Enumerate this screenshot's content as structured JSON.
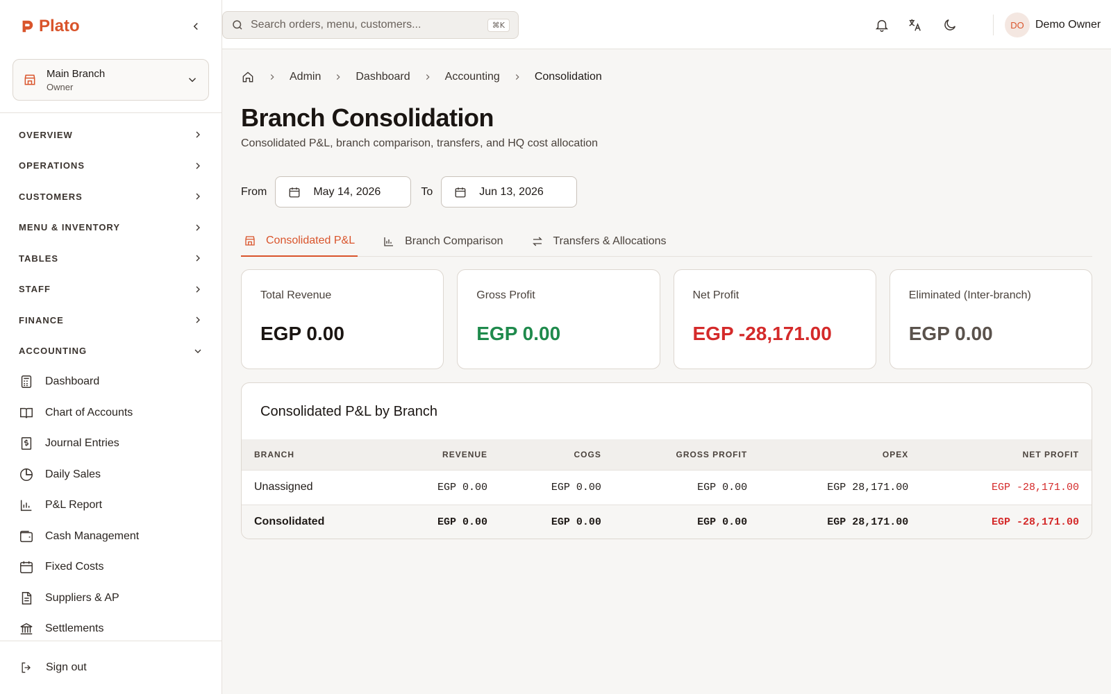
{
  "app": {
    "name": "Plato"
  },
  "branch": {
    "name": "Main Branch",
    "role": "Owner"
  },
  "nav": {
    "sections": [
      "OVERVIEW",
      "OPERATIONS",
      "CUSTOMERS",
      "MENU & INVENTORY",
      "TABLES",
      "STAFF",
      "FINANCE",
      "ACCOUNTING"
    ],
    "accounting_items": [
      "Dashboard",
      "Chart of Accounts",
      "Journal Entries",
      "Daily Sales",
      "P&L Report",
      "Cash Management",
      "Fixed Costs",
      "Suppliers & AP",
      "Settlements"
    ],
    "signout": "Sign out"
  },
  "search": {
    "placeholder": "Search orders, menu, customers...",
    "shortcut": "⌘K"
  },
  "user": {
    "initials": "DO",
    "name": "Demo Owner"
  },
  "breadcrumb": [
    "Admin",
    "Dashboard",
    "Accounting",
    "Consolidation"
  ],
  "page": {
    "title": "Branch Consolidation",
    "subtitle": "Consolidated P&L, branch comparison, transfers, and HQ cost allocation"
  },
  "dates": {
    "from_label": "From",
    "from": "May 14, 2026",
    "to_label": "To",
    "to": "Jun 13, 2026"
  },
  "tabs": [
    "Consolidated P&L",
    "Branch Comparison",
    "Transfers & Allocations"
  ],
  "cards": [
    {
      "label": "Total Revenue",
      "value": "EGP 0.00",
      "color": "#1a1512"
    },
    {
      "label": "Gross Profit",
      "value": "EGP 0.00",
      "color": "#1f8a4c"
    },
    {
      "label": "Net Profit",
      "value": "EGP -28,171.00",
      "color": "#d42a2a"
    },
    {
      "label": "Eliminated (Inter-branch)",
      "value": "EGP 0.00",
      "color": "#5a524c"
    }
  ],
  "table": {
    "title": "Consolidated P&L by Branch",
    "headers": [
      "BRANCH",
      "REVENUE",
      "COGS",
      "GROSS PROFIT",
      "OPEX",
      "NET PROFIT"
    ],
    "rows": [
      [
        "Unassigned",
        "EGP 0.00",
        "EGP 0.00",
        "EGP 0.00",
        "EGP 28,171.00",
        "EGP -28,171.00"
      ]
    ],
    "total": [
      "Consolidated",
      "EGP 0.00",
      "EGP 0.00",
      "EGP 0.00",
      "EGP 28,171.00",
      "EGP -28,171.00"
    ],
    "negative_color": "#d42a2a"
  }
}
